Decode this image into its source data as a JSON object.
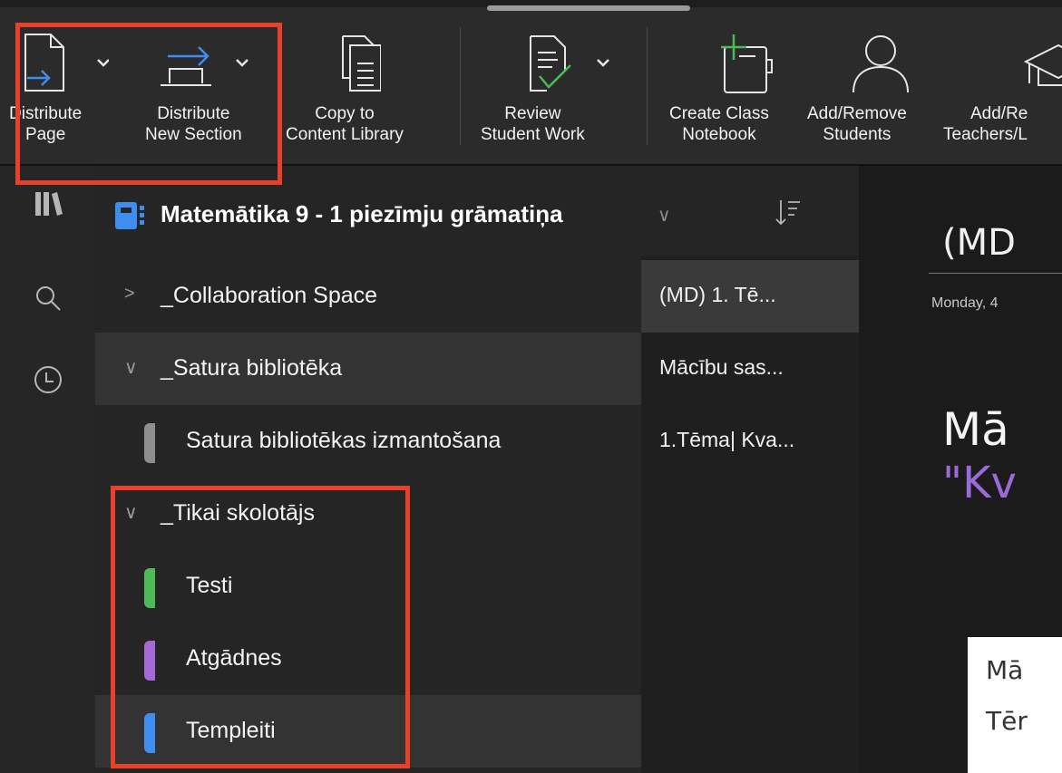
{
  "ribbon": {
    "buttons": [
      {
        "label1": "Distribute",
        "label2": "Page"
      },
      {
        "label1": "Distribute",
        "label2": "New Section"
      },
      {
        "label1": "Copy to",
        "label2": "Content Library"
      },
      {
        "label1": "Review",
        "label2": "Student Work"
      },
      {
        "label1": "Create Class",
        "label2": "Notebook"
      },
      {
        "label1": "Add/Remove",
        "label2": "Students"
      },
      {
        "label1": "Add/Re",
        "label2": "Teachers/L"
      }
    ]
  },
  "notebook": {
    "title": "Matemātika 9 - 1 piezīmju grāmatiņa",
    "chevron": "∨"
  },
  "sections": [
    {
      "label": "_Collaboration Space",
      "chevron": ">"
    },
    {
      "label": "_Satura bibliotēka",
      "chevron": "∨"
    },
    {
      "label": "Satura bibliotēkas izmantošana",
      "color": "#8e8e8e"
    },
    {
      "label": "_Tikai skolotājs",
      "chevron": "∨"
    },
    {
      "label": "Testi",
      "color": "#4cbb55"
    },
    {
      "label": "Atgādnes",
      "color": "#a66ad8"
    },
    {
      "label": "Templeiti",
      "color": "#3d8ef0"
    }
  ],
  "pages": [
    {
      "label": "(MD) 1. Tē..."
    },
    {
      "label": "Mācību sas..."
    },
    {
      "label": "1.Tēma| Kva..."
    }
  ],
  "canvas": {
    "page_title": "(MD",
    "date": "Monday, 4",
    "heading": "Mā",
    "subheading": "\"Kv",
    "card_line1": "Mā",
    "card_line2": "Tēr"
  },
  "colors": {
    "highlight": "#e8412b",
    "notebook_icon": "#3d8ef0"
  }
}
